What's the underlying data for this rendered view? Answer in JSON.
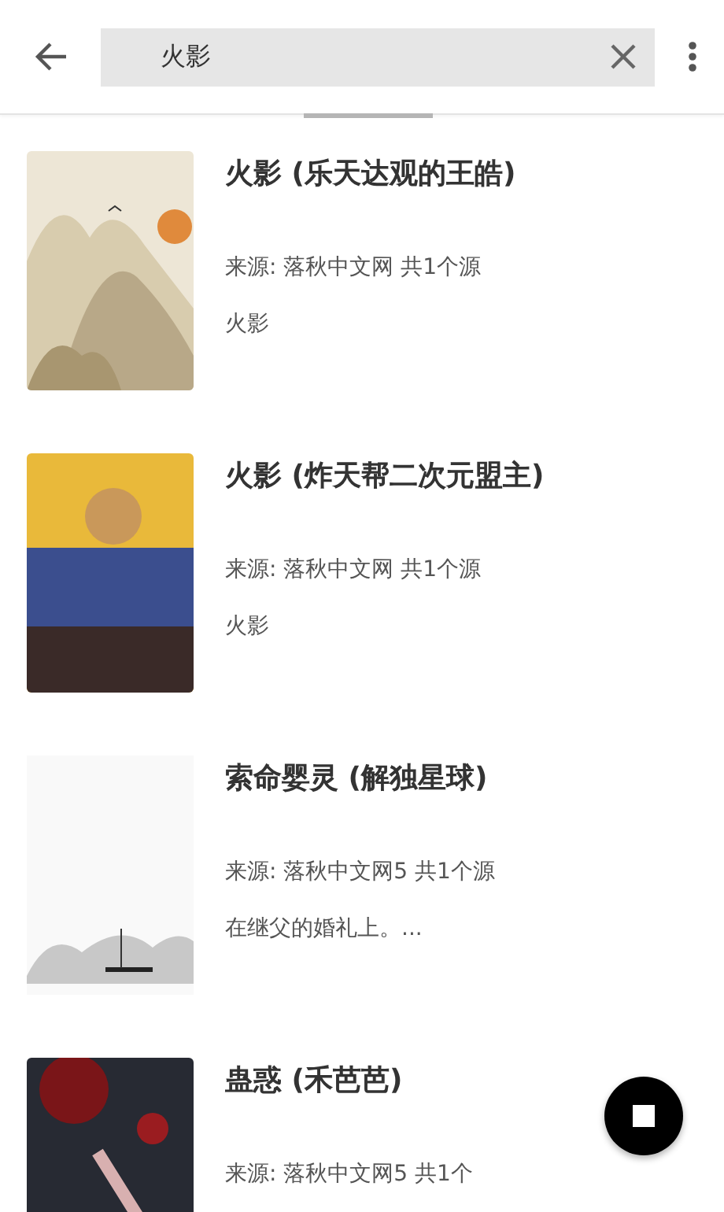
{
  "search": {
    "value": "火影"
  },
  "books": [
    {
      "title": "火影 (乐天达观的王皓)",
      "source": "来源: 落秋中文网 共1个源",
      "intro": "火影",
      "kind": "mountain"
    },
    {
      "title": "火影 (炸天帮二次元盟主)",
      "source": "来源: 落秋中文网 共1个源",
      "intro": "火影",
      "kind": "artwork"
    },
    {
      "title": "索命婴灵 (解独星球)",
      "source": "来源: 落秋中文网5 共1个源",
      "intro": "在继父的婚礼上。...",
      "kind": "ink"
    },
    {
      "title": "蛊惑 (禾芭芭)",
      "source": "来源: 落秋中文网5 共1个",
      "kind": "dark"
    }
  ]
}
